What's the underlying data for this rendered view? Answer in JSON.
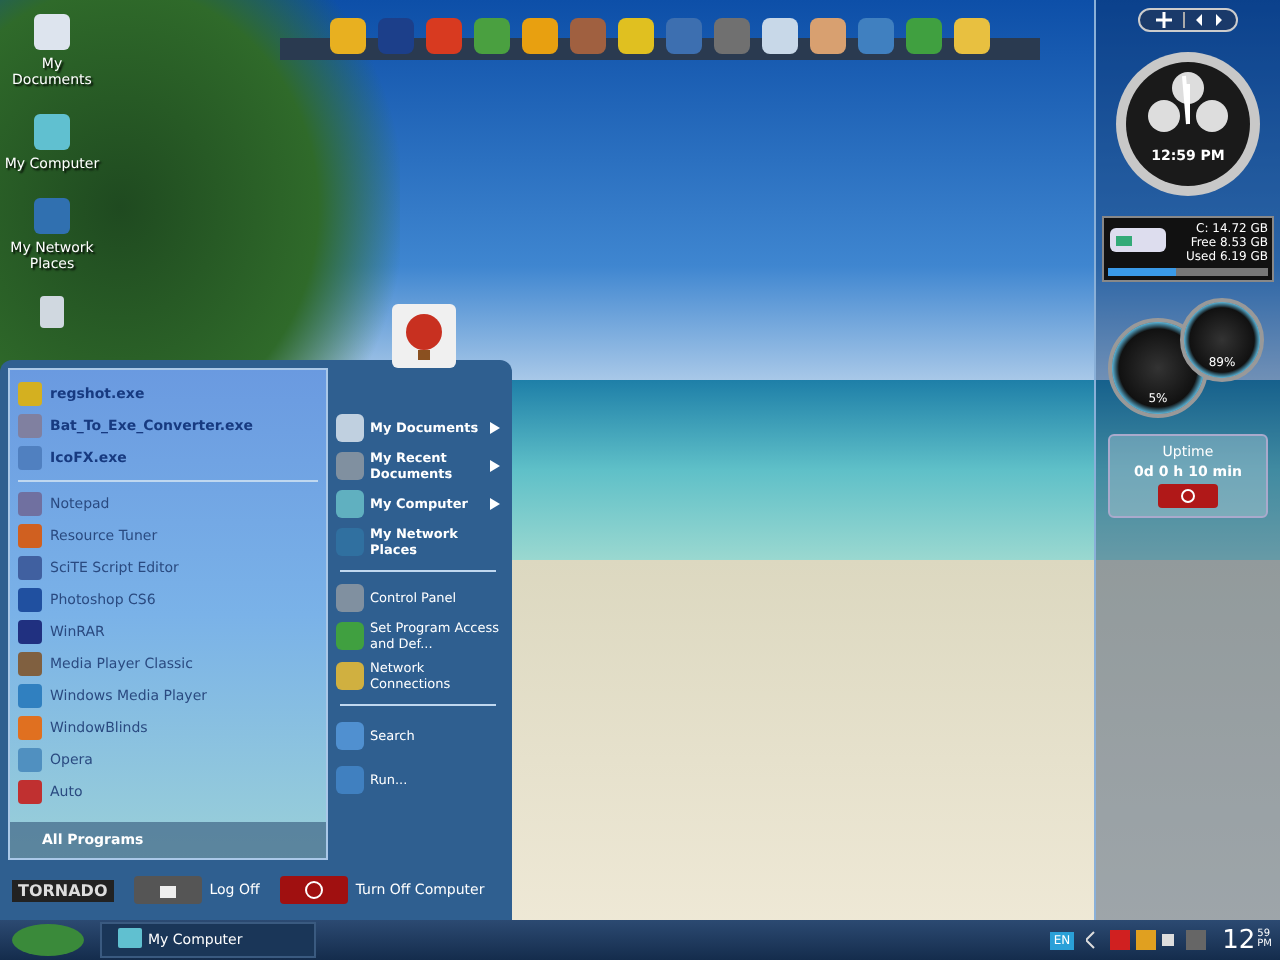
{
  "desktop_icons": [
    {
      "label": "My Documents"
    },
    {
      "label": "My Computer"
    },
    {
      "label": "My Network Places"
    }
  ],
  "start_menu": {
    "pinned": [
      "regshot.exe",
      "Bat_To_Exe_Converter.exe",
      "IcoFX.exe"
    ],
    "recent": [
      "Notepad",
      "Resource Tuner",
      "SciTE Script Editor",
      "Photoshop CS6",
      "WinRAR",
      "Media Player Classic",
      "Windows Media Player",
      "WindowBlinds",
      "Opera",
      "Auto"
    ],
    "all_programs": "All Programs",
    "places": [
      {
        "label": "My Documents",
        "submenu": true,
        "kind": "folder"
      },
      {
        "label": "My Recent Documents",
        "submenu": true,
        "kind": "folder"
      },
      {
        "label": "My Computer",
        "submenu": true,
        "kind": "folder"
      },
      {
        "label": "My Network Places",
        "submenu": false,
        "kind": "folder"
      },
      {
        "label": "Control Panel",
        "submenu": false,
        "kind": "setting"
      },
      {
        "label": "Set Program Access and Def...",
        "submenu": false,
        "kind": "setting"
      },
      {
        "label": "Network Connections",
        "submenu": false,
        "kind": "setting"
      },
      {
        "label": "Search",
        "submenu": false,
        "kind": "command"
      },
      {
        "label": "Run...",
        "submenu": false,
        "kind": "command"
      }
    ],
    "brand": "TORNADO",
    "log_off": "Log Off",
    "turn_off": "Turn Off Computer"
  },
  "sidebar": {
    "clock": "12:59 PM",
    "drive": {
      "name": "C:  14.72 GB",
      "free": "Free 8.53 GB",
      "used": "Used 6.19 GB",
      "level": 0.42
    },
    "gauges": [
      "5%",
      "89%"
    ],
    "uptime": {
      "title": "Uptime",
      "value": "0d 0 h 10 min"
    }
  },
  "taskbar": {
    "task": "My Computer",
    "language": "EN",
    "clock_hour": "12",
    "clock_minute": "59",
    "clock_ampm": "PM"
  }
}
